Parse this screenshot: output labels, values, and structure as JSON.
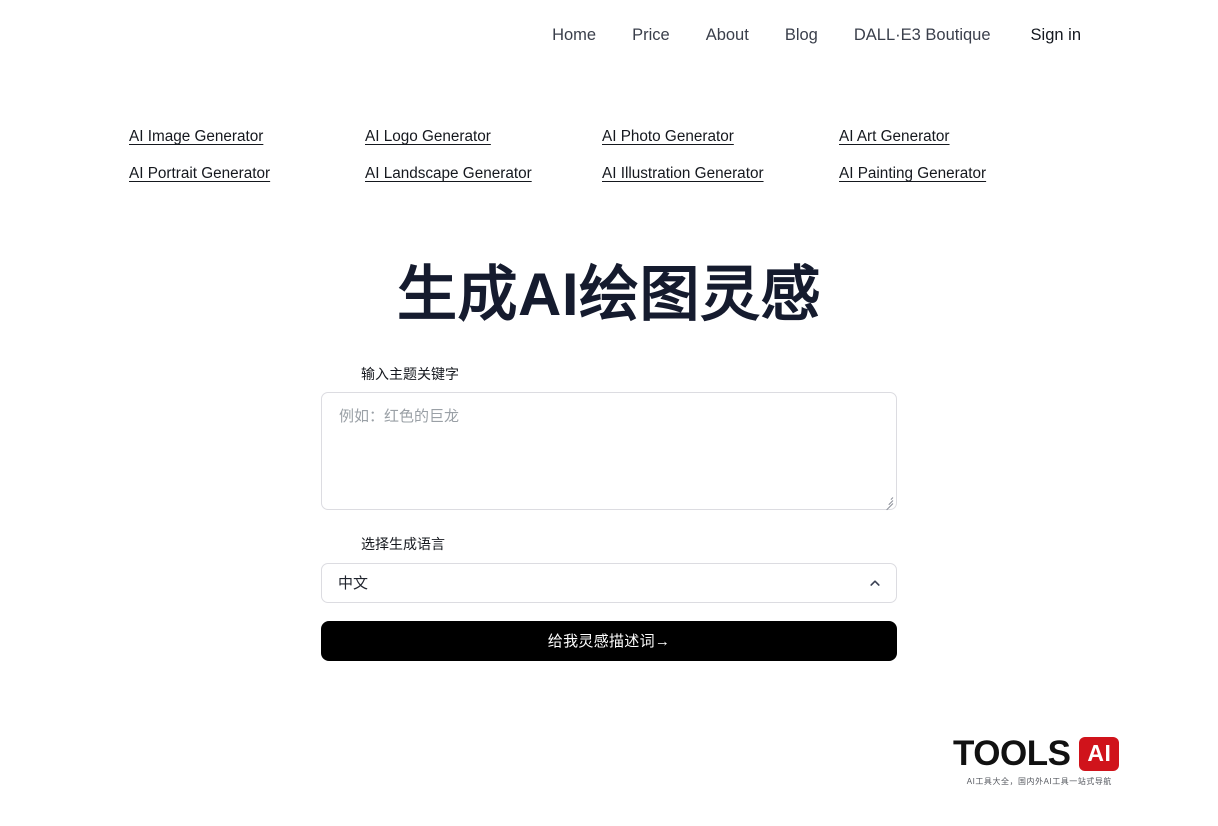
{
  "nav": {
    "items": [
      {
        "label": "Home",
        "name": "nav-link-home"
      },
      {
        "label": "Price",
        "name": "nav-link-price"
      },
      {
        "label": "About",
        "name": "nav-link-about"
      },
      {
        "label": "Blog",
        "name": "nav-link-blog"
      },
      {
        "label": "DALL·E3 Boutique",
        "name": "nav-link-dalle3-boutique"
      }
    ],
    "signin": "Sign in"
  },
  "generator_links": [
    "AI Image Generator",
    "AI Logo Generator",
    "AI Photo Generator",
    "AI Art Generator",
    "AI Portrait Generator",
    "AI Landscape Generator",
    "AI Illustration Generator",
    "AI Painting Generator"
  ],
  "hero": {
    "title": "生成AI绘图灵感"
  },
  "form": {
    "prompt_label": "输入主题关键字",
    "prompt_placeholder": "例如：红色的巨龙",
    "prompt_value": "",
    "language_label": "选择生成语言",
    "language_value": "中文",
    "language_options": [
      "中文"
    ],
    "chevron_icon": "chevron-up-icon",
    "submit_label": "给我灵感描述词→"
  },
  "brand": {
    "word": "TOOLS",
    "badge": "AI",
    "tagline": "AI工具大全，国内外AI工具一站式导航",
    "badge_color": "#d0131b"
  },
  "colors": {
    "heading": "#151b2e",
    "button_bg": "#000000",
    "border": "#dcdce1",
    "placeholder": "#9aa0a6",
    "accent_red": "#d0131b"
  }
}
